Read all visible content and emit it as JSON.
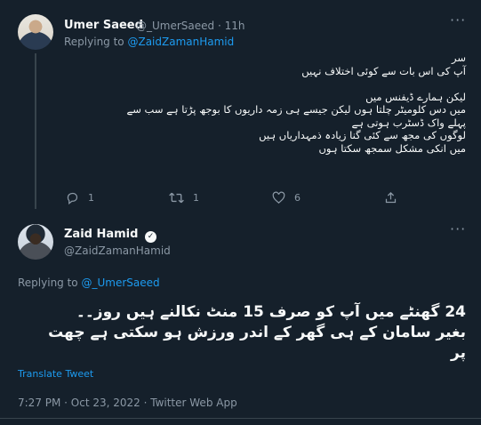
{
  "tweet1": {
    "author_name": "Umer Saeed",
    "author_handle": "@_UmerSaeed",
    "separator": "·",
    "time": "11h",
    "replying_prefix": "Replying to",
    "replying_to": "@ZaidZamanHamid",
    "lines": [
      "سر",
      "آپ کی اس بات سے کوئی اختلاف نہیں",
      "",
      "لیکن ہمارے ڈیفنس میں",
      "میں دس کلومیٹر چلتا ہوں لیکن جیسے ہی زمہ داریوں کا بوجھ پڑتا ہے سب سے",
      "پہلے واک ڈسٹرب ہوتی ہے",
      "لوگوں کی مجھ سے کئی گنا زیادہ ذمہداریاں ہیں",
      "میں انکی مشکل سمجھ سکتا ہوں"
    ],
    "reply_count": "1",
    "retweet_count": "1",
    "like_count": "6"
  },
  "tweet2": {
    "author_name": "Zaid Hamid",
    "author_handle": "@ZaidZamanHamid",
    "replying_prefix": "Replying to",
    "replying_to": "@_UmerSaeed",
    "lines": [
      "24 گھنٹے میں آپ کو صرف 15 منٹ نکالنے ہیں روز۔۔",
      "بغیر سامان کے ہی گھر کے اندر ورزش ہو سکتی ہے چھت",
      "پر"
    ],
    "translate_label": "Translate Tweet",
    "timestamp": "7:27 PM · Oct 23, 2022 · Twitter Web App"
  },
  "icons": {
    "more": "more-icon",
    "reply": "reply-icon",
    "retweet": "retweet-icon",
    "like": "like-icon",
    "share": "share-icon",
    "verified": "verified-icon"
  },
  "colors": {
    "background": "#15202b",
    "text": "#f7f9f9",
    "muted": "#8b98a5",
    "link": "#1d9bf0",
    "divider": "#38444d"
  }
}
